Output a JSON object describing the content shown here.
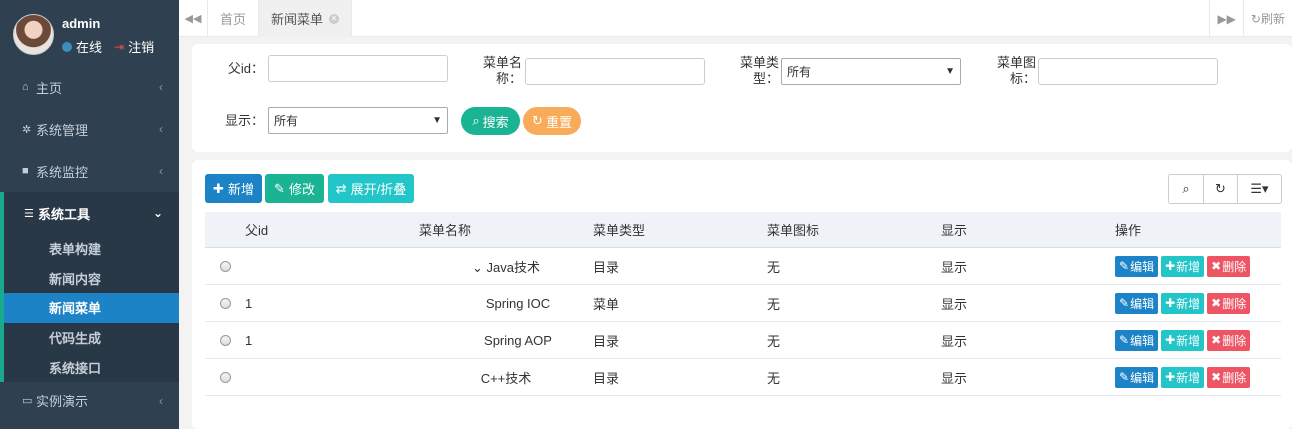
{
  "user": {
    "name": "admin",
    "status": "在线",
    "logout": "注销"
  },
  "sidebar": {
    "items": [
      {
        "icon": "home-icon",
        "glyph": "⌂",
        "label": "主页"
      },
      {
        "icon": "gear-icon",
        "glyph": "✲",
        "label": "系统管理"
      },
      {
        "icon": "video-icon",
        "glyph": "■",
        "label": "系统监控"
      },
      {
        "icon": "list-icon",
        "glyph": "☰",
        "label": "系统工具"
      },
      {
        "icon": "desktop-icon",
        "glyph": "▭",
        "label": "实例演示"
      }
    ],
    "subitems": [
      "表单构建",
      "新闻内容",
      "新闻菜单",
      "代码生成",
      "系统接口"
    ]
  },
  "tabs": {
    "home": "首页",
    "active": "新闻菜单",
    "refresh": "刷新"
  },
  "search": {
    "parent_id_label": "父id：",
    "menu_name_label": "菜单名称：",
    "menu_type_label": "菜单类型：",
    "menu_type_value": "所有",
    "menu_icon_label": "菜单图标：",
    "display_label": "显示：",
    "display_value": "所有",
    "search_btn": "搜索",
    "reset_btn": "重置"
  },
  "toolbar": {
    "add": "新增",
    "edit": "修改",
    "expand": "展开/折叠"
  },
  "table": {
    "headers": [
      "父id",
      "菜单名称",
      "菜单类型",
      "菜单图标",
      "显示",
      "操作"
    ],
    "actions": {
      "edit": "编辑",
      "add": "新增",
      "delete": "删除"
    },
    "rows": [
      {
        "parent_id": "",
        "name": "Java技术",
        "type": "目录",
        "icon": "无",
        "display": "显示",
        "expandable": true,
        "indent": 0
      },
      {
        "parent_id": "1",
        "name": "Spring IOC",
        "type": "菜单",
        "icon": "无",
        "display": "显示",
        "expandable": false,
        "indent": 1
      },
      {
        "parent_id": "1",
        "name": "Spring AOP",
        "type": "目录",
        "icon": "无",
        "display": "显示",
        "expandable": false,
        "indent": 1
      },
      {
        "parent_id": "",
        "name": "C++技术",
        "type": "目录",
        "icon": "无",
        "display": "显示",
        "expandable": false,
        "indent": 0
      }
    ]
  },
  "colors": {
    "sidebar": "#2f4050",
    "primary": "#1c84c6",
    "green": "#1ab394",
    "teal": "#23c6c8",
    "red": "#ed5565",
    "orange": "#f8ac59"
  }
}
